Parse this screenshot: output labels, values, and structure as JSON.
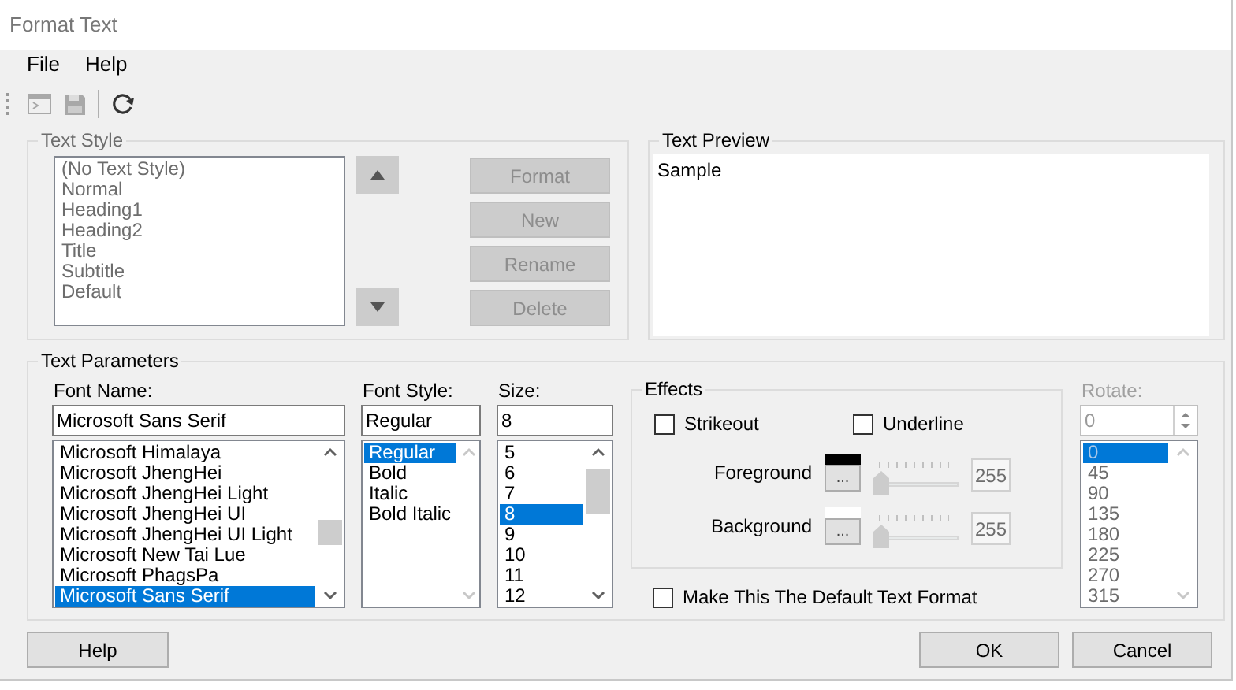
{
  "window": {
    "title": "Format Text"
  },
  "menu": [
    {
      "label": "File"
    },
    {
      "label": "Help"
    }
  ],
  "toolbar": [
    {
      "kind": "console",
      "disabled": true
    },
    {
      "kind": "save",
      "disabled": true
    },
    {
      "kind": "separator"
    },
    {
      "kind": "refresh",
      "disabled": false
    }
  ],
  "text_style": {
    "title": "Text Style",
    "disabled": true,
    "items": [
      {
        "label": "(No Text Style)",
        "selected": false
      },
      {
        "label": "Normal",
        "selected": false
      },
      {
        "label": "Heading1",
        "selected": false
      },
      {
        "label": "Heading2",
        "selected": false
      },
      {
        "label": "Title",
        "selected": false
      },
      {
        "label": "Subtitle",
        "selected": false
      },
      {
        "label": "Default",
        "selected": false
      }
    ],
    "buttons": [
      "Format",
      "New",
      "Rename",
      "Delete"
    ]
  },
  "text_preview": {
    "title": "Text Preview",
    "sample": "Sample"
  },
  "text_parameters": {
    "title": "Text Parameters",
    "font_name": {
      "label": "Font Name:",
      "value": "Microsoft Sans Serif",
      "items": [
        {
          "label": "Microsoft Himalaya",
          "selected": false
        },
        {
          "label": "Microsoft JhengHei",
          "selected": false
        },
        {
          "label": "Microsoft JhengHei Light",
          "selected": false
        },
        {
          "label": "Microsoft JhengHei UI",
          "selected": false
        },
        {
          "label": "Microsoft JhengHei UI Light",
          "selected": false
        },
        {
          "label": "Microsoft New Tai Lue",
          "selected": false
        },
        {
          "label": "Microsoft PhagsPa",
          "selected": false
        },
        {
          "label": "Microsoft Sans Serif",
          "selected": true
        }
      ]
    },
    "font_style": {
      "label": "Font Style:",
      "value": "Regular",
      "items": [
        {
          "label": "Regular",
          "selected": true
        },
        {
          "label": "Bold",
          "selected": false
        },
        {
          "label": "Italic",
          "selected": false
        },
        {
          "label": "Bold Italic",
          "selected": false
        }
      ]
    },
    "size": {
      "label": "Size:",
      "value": "8",
      "items": [
        {
          "label": "5",
          "selected": false
        },
        {
          "label": "6",
          "selected": false
        },
        {
          "label": "7",
          "selected": false
        },
        {
          "label": "8",
          "selected": true
        },
        {
          "label": "9",
          "selected": false
        },
        {
          "label": "10",
          "selected": false
        },
        {
          "label": "11",
          "selected": false
        },
        {
          "label": "12",
          "selected": false
        }
      ]
    },
    "effects": {
      "title": "Effects",
      "strikeout": {
        "label": "Strikeout",
        "checked": false
      },
      "underline": {
        "label": "Underline",
        "checked": false
      },
      "colors": [
        {
          "label": "Foreground",
          "color": "#000000",
          "button": "...",
          "level": 0,
          "value": "255"
        },
        {
          "label": "Background",
          "color": "#ffffff",
          "button": "...",
          "level": 0,
          "value": "255"
        }
      ]
    },
    "default_format": {
      "label": "Make This The Default Text Format",
      "checked": false
    },
    "rotate": {
      "label": "Rotate:",
      "value": "0",
      "disabled": true,
      "items": [
        {
          "label": "0",
          "selected": true
        },
        {
          "label": "45",
          "selected": false
        },
        {
          "label": "90",
          "selected": false
        },
        {
          "label": "135",
          "selected": false
        },
        {
          "label": "180",
          "selected": false
        },
        {
          "label": "225",
          "selected": false
        },
        {
          "label": "270",
          "selected": false
        },
        {
          "label": "315",
          "selected": false
        }
      ]
    }
  },
  "footer": {
    "help": "Help",
    "ok": "OK",
    "cancel": "Cancel"
  }
}
